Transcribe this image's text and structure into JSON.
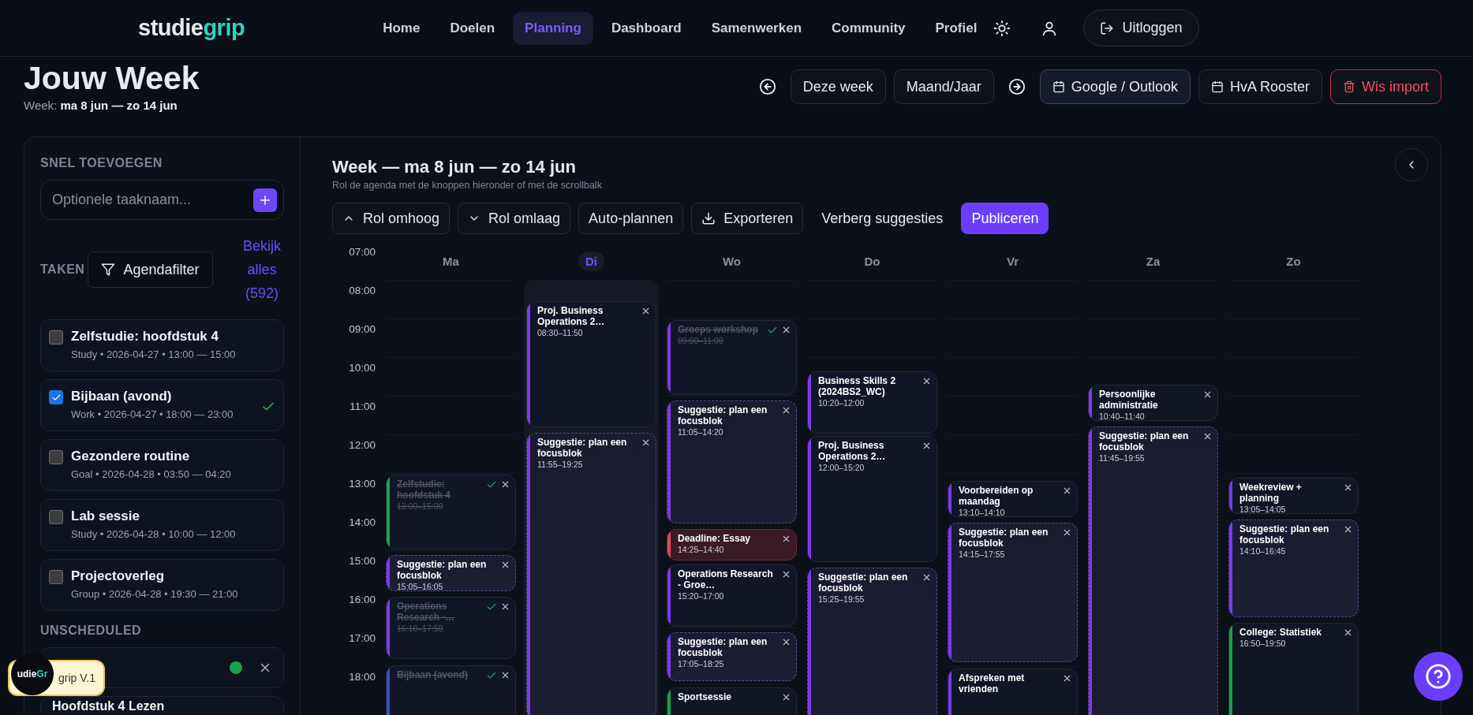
{
  "brand": {
    "part_a": "studie",
    "part_b": "grip"
  },
  "nav": [
    {
      "label": "Home",
      "selected": false
    },
    {
      "label": "Doelen",
      "selected": false
    },
    {
      "label": "Planning",
      "selected": true
    },
    {
      "label": "Dashboard",
      "selected": false
    },
    {
      "label": "Samenwerken",
      "selected": false
    },
    {
      "label": "Community",
      "selected": false
    },
    {
      "label": "Profiel",
      "selected": false
    }
  ],
  "logout": "Uitloggen",
  "page": {
    "title": "Jouw Week",
    "week": "Week: **ma 8 jun — zo 14 jun**"
  },
  "actions": [
    {
      "kind": "prev"
    },
    {
      "kind": "button",
      "label": "Deze week"
    },
    {
      "kind": "button",
      "label": "Maand/Jaar"
    },
    {
      "kind": "next"
    },
    {
      "kind": "import",
      "label": "Google / Outlook",
      "selected": true
    },
    {
      "kind": "import",
      "label": "HvA Rooster",
      "selected": false
    },
    {
      "kind": "danger",
      "label": "Wis import"
    }
  ],
  "sidebar": {
    "quick_add_heading": "SNEL TOEVOEGEN",
    "placeholder": "Optionele taaknaam...",
    "tasks_heading": "TAKEN",
    "filter": "Agendafilter",
    "view_all": "Bekijk alles (592)",
    "tasks": [
      {
        "title": "Zelfstudie: hoofdstuk 4",
        "meta": "Study • 2026-04-27 • 13:00 — 15:00",
        "checked": false
      },
      {
        "title": "Bijbaan (avond)",
        "meta": "Work • 2026-04-27 • 18:00 — 23:00",
        "checked": true
      },
      {
        "title": "Gezondere routine",
        "meta": "Goal • 2026-04-28 • 03:50 — 04:20",
        "checked": false
      },
      {
        "title": "Lab sessie",
        "meta": "Study • 2026-04-28 • 10:00 — 12:00",
        "checked": false
      },
      {
        "title": "Projectoverleg",
        "meta": "Group • 2026-04-28 • 19:30 — 21:00",
        "checked": false
      }
    ],
    "unscheduled_heading": "UNSCHEDULED",
    "unscheduled": [
      {
        "color": "#16a34a"
      },
      {
        "title": "Hoofdstuk 4 Lezen"
      }
    ]
  },
  "calendar": {
    "title": "Week — ma 8 jun — zo 14 jun",
    "subtitle": "Rol de agenda met de knoppen hieronder of met de scrollbalk",
    "toolbar": [
      {
        "kind": "up",
        "label": "Rol omhoog"
      },
      {
        "kind": "down",
        "label": "Rol omlaag"
      },
      {
        "kind": "plain",
        "label": "Auto-plannen"
      },
      {
        "kind": "export",
        "label": "Exporteren"
      },
      {
        "kind": "text",
        "label": "Verberg suggesties"
      },
      {
        "kind": "primary",
        "label": "Publiceren"
      }
    ],
    "hours": [
      "07:00",
      "08:00",
      "09:00",
      "10:00",
      "11:00",
      "12:00",
      "13:00",
      "14:00",
      "15:00",
      "16:00",
      "17:00",
      "18:00"
    ],
    "days": [
      {
        "label": "Ma",
        "selected": false,
        "events": [
          {
            "kind": "event",
            "title": "Zelfstudie: hoofdstuk 4",
            "time": "13:00–15:00",
            "done": true,
            "color": "#16a34a"
          },
          {
            "kind": "suggestion",
            "title": "Suggestie: plan een focusblok",
            "time": "15:05–16:05",
            "done": false,
            "color": "#7c3aed"
          },
          {
            "kind": "event",
            "title": "Operations Research -…",
            "time": "16:10–17:50",
            "done": true,
            "color": "#7c3aed"
          },
          {
            "kind": "event",
            "title": "Bijbaan (avond)",
            "done": true,
            "color": "#3b4fc4"
          }
        ]
      },
      {
        "label": "Di",
        "selected": true,
        "events": [
          {
            "kind": "event",
            "title": "Proj. Business Operations 2…",
            "time": "08:30–11:50",
            "done": false,
            "color": "#7c3aed"
          },
          {
            "kind": "suggestion",
            "title": "Suggestie: plan een focusblok",
            "time": "11:55–19:25",
            "done": false,
            "color": "#7c3aed"
          }
        ]
      },
      {
        "label": "Wo",
        "selected": false,
        "events": [
          {
            "kind": "event",
            "title": "Groeps workshop",
            "time": "09:00–11:00",
            "done": true,
            "color": "#7c3aed"
          },
          {
            "kind": "suggestion",
            "title": "Suggestie: plan een focusblok",
            "time": "11:05–14:20",
            "done": false,
            "color": "#7c3aed"
          },
          {
            "kind": "deadline",
            "title": "Deadline: Essay",
            "time": "14:25–14:40",
            "done": false,
            "color": "#e5485d"
          },
          {
            "kind": "event",
            "title": "Operations Research - Groe…",
            "time": "15:20–17:00",
            "done": false,
            "color": "#7c3aed"
          },
          {
            "kind": "suggestion",
            "title": "Suggestie: plan een focusblok",
            "time": "17:05–18:25",
            "done": false,
            "color": "#7c3aed"
          },
          {
            "kind": "event",
            "title": "Sportsessie",
            "done": false,
            "color": "#16a34a"
          }
        ]
      },
      {
        "label": "Do",
        "selected": false,
        "events": [
          {
            "kind": "event",
            "title": "Business Skills 2 (2024BS2_WC)",
            "time": "10:20–12:00",
            "done": false,
            "color": "#7c3aed"
          },
          {
            "kind": "event",
            "title": "Proj. Business Operations 2…",
            "time": "12:00–15:20",
            "done": false,
            "color": "#7c3aed"
          },
          {
            "kind": "suggestion",
            "title": "Suggestie: plan een focusblok",
            "time": "15:25–19:55",
            "done": false,
            "color": "#7c3aed"
          }
        ]
      },
      {
        "label": "Vr",
        "selected": false,
        "events": [
          {
            "kind": "event",
            "title": "Voorbereiden op maandag",
            "time": "13:10–14:10",
            "done": false,
            "color": "#7c3aed"
          },
          {
            "kind": "suggestion",
            "title": "Suggestie: plan een focusblok",
            "time": "14:15–17:55",
            "done": false,
            "color": "#7c3aed"
          },
          {
            "kind": "event",
            "title": "Afspreken met vrienden",
            "done": false,
            "color": "#7c3aed"
          }
        ]
      },
      {
        "label": "Za",
        "selected": false,
        "events": [
          {
            "kind": "event",
            "title": "Persoonlijke administratie",
            "time": "10:40–11:40",
            "done": false,
            "color": "#7c3aed"
          },
          {
            "kind": "suggestion",
            "title": "Suggestie: plan een focusblok",
            "time": "11:45–19:55",
            "done": false,
            "color": "#7c3aed"
          }
        ]
      },
      {
        "label": "Zo",
        "selected": false,
        "events": [
          {
            "kind": "event",
            "title": "Weekreview + planning",
            "time": "13:05–14:05",
            "done": false,
            "color": "#7c3aed"
          },
          {
            "kind": "suggestion",
            "title": "Suggestie: plan een focusblok",
            "time": "14:10–16:45",
            "done": false,
            "color": "#7c3aed"
          },
          {
            "kind": "event",
            "title": "College: Statistiek",
            "time": "16:50–19:50",
            "done": false,
            "color": "#16a34a"
          }
        ]
      }
    ]
  },
  "badge": {
    "part_a": "udie",
    "part_b": "Gr",
    "label": "grip V.1"
  }
}
